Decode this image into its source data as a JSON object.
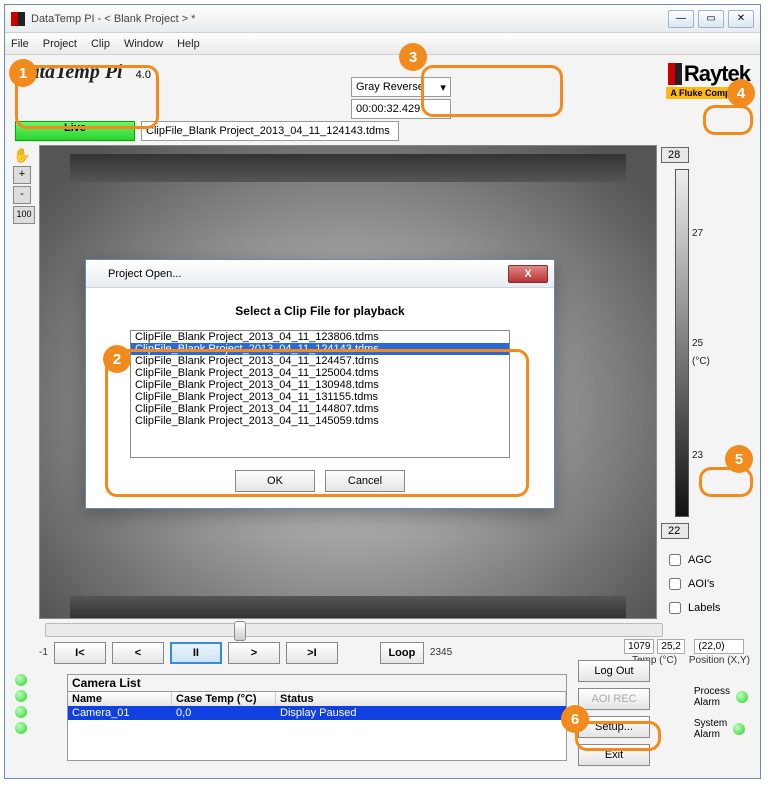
{
  "window": {
    "title": "DataTemp PI - < Blank Project > *"
  },
  "menu": {
    "file": "File",
    "project": "Project",
    "clip": "Clip",
    "window": "Window",
    "help": "Help"
  },
  "header": {
    "app": "DataTemp Pi",
    "ver": "4.0",
    "brand": "Raytek",
    "brandsub": "A Fluke Company"
  },
  "live": {
    "btn": "Live",
    "file": "ClipFile_Blank Project_2013_04_11_124143.tdms",
    "palette": "Gray Reverse",
    "time": "00:00:32.429"
  },
  "leftbtns": {
    "plus": "+",
    "minus": "-",
    "hundred": "100"
  },
  "scale": {
    "max": "28",
    "min": "22",
    "unit": "(°C)",
    "ticks": {
      "t27": "27",
      "t25": "25",
      "t23": "23"
    }
  },
  "checks": {
    "agc": "AGC",
    "aoi": "AOI's",
    "labels": "Labels"
  },
  "slider": {
    "left": "-1",
    "right": "2345",
    "frame": "1079",
    "temp": "25,2",
    "tlbl": "Temp (°C)",
    "pos": "(22,0)",
    "poslbl": "Position (X,Y)",
    "btns": {
      "first": "I<",
      "prev": "<",
      "pause": "II",
      "next": ">",
      "last": ">I",
      "loop": "Loop"
    }
  },
  "camlist": {
    "title": "Camera List",
    "cols": {
      "name": "Name",
      "case": "Case Temp (°C)",
      "status": "Status"
    },
    "row": {
      "name": "Camera_01",
      "case": "0,0",
      "status": "Display Paused"
    }
  },
  "rbtns": {
    "logout": "Log Out",
    "aoirec": "AOI REC",
    "setup": "Setup...",
    "exit": "Exit"
  },
  "alarm": {
    "proc": "Process\nAlarm",
    "sys": "System\nAlarm"
  },
  "modal": {
    "title": "Project Open...",
    "instr": "Select a Clip File for playback",
    "ok": "OK",
    "cancel": "Cancel",
    "files": [
      "ClipFile_Blank Project_2013_04_11_123806.tdms",
      "ClipFile_Blank Project_2013_04_11_124143.tdms",
      "ClipFile_Blank Project_2013_04_11_124457.tdms",
      "ClipFile_Blank Project_2013_04_11_125004.tdms",
      "ClipFile_Blank Project_2013_04_11_130948.tdms",
      "ClipFile_Blank Project_2013_04_11_131155.tdms",
      "ClipFile_Blank Project_2013_04_11_144807.tdms",
      "ClipFile_Blank Project_2013_04_11_145059.tdms"
    ],
    "selected": 1
  }
}
